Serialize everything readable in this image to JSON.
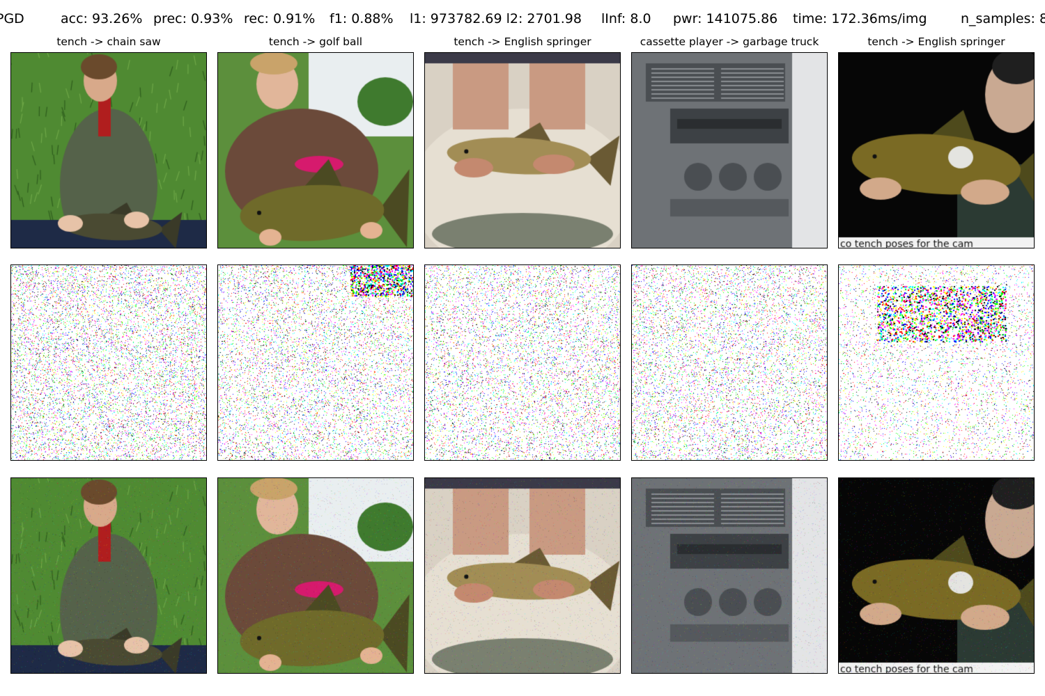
{
  "header": {
    "method": "PGD",
    "acc": "acc: 93.26%",
    "prec": "prec: 0.93%",
    "rec": "rec: 0.91%",
    "f1": "f1: 0.88%",
    "l1l2": "l1: 973782.69 l2: 2701.98",
    "linf": "lInf: 8.0",
    "pwr": "pwr: 141075.86",
    "time": "time: 172.36ms/img",
    "n_samples": "n_samples: 8"
  },
  "columns": [
    {
      "title": "tench -> chain saw",
      "scene": "boy-field"
    },
    {
      "title": "tench -> golf ball",
      "scene": "boy-brown"
    },
    {
      "title": "tench -> English springer",
      "scene": "hands-bowl"
    },
    {
      "title": "cassette player -> garbage truck",
      "scene": "car-dash"
    },
    {
      "title": "tench -> English springer",
      "scene": "night-man"
    }
  ],
  "watermark_text": "co tench poses for the cam",
  "colors": {
    "noise": [
      "#ff00ff",
      "#00ffff",
      "#ffff00",
      "#0000ff",
      "#00ff00",
      "#ff0000",
      "#000000"
    ]
  }
}
